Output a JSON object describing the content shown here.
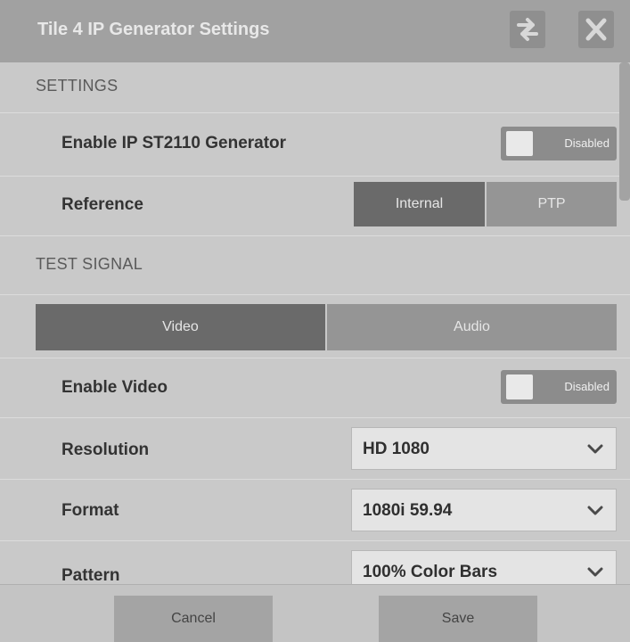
{
  "window": {
    "title": "Tile 4 IP Generator Settings"
  },
  "settings": {
    "section_title": "SETTINGS",
    "enable_generator": {
      "label": "Enable IP ST2110 Generator",
      "state": "Disabled"
    },
    "reference": {
      "label": "Reference",
      "options": [
        "Internal",
        "PTP"
      ],
      "selected": "Internal"
    }
  },
  "test_signal": {
    "section_title": "TEST SIGNAL",
    "tabs": [
      "Video",
      "Audio"
    ],
    "active_tab": "Video",
    "enable_video": {
      "label": "Enable Video",
      "state": "Disabled"
    },
    "resolution": {
      "label": "Resolution",
      "value": "HD 1080"
    },
    "format": {
      "label": "Format",
      "value": "1080i 59.94"
    },
    "pattern": {
      "label": "Pattern",
      "value": "100% Color Bars"
    }
  },
  "footer": {
    "cancel_label": "Cancel",
    "save_label": "Save"
  },
  "colors": {
    "active_segment": "#6a6a6a",
    "inactive_segment": "#959595",
    "titlebar": "#a1a1a1"
  },
  "icons": {
    "swap": "swap-arrows-icon",
    "close": "close-icon",
    "chevron": "chevron-down-icon"
  }
}
